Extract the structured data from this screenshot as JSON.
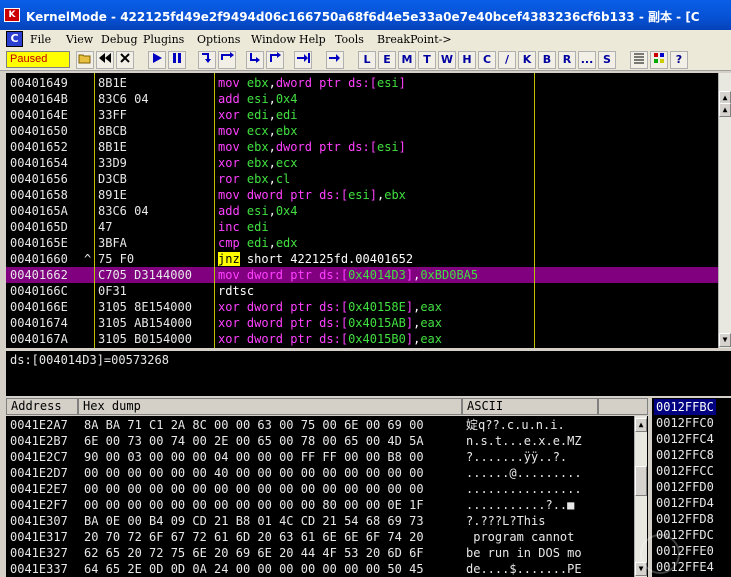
{
  "window": {
    "title": "KernelMode - 422125fd49e2f9494d06c166750a68f6d4e5e33a0e7e40bcef4383236cf6b133 - 副本 - [C",
    "icon_letter": "K"
  },
  "menu": {
    "c_label": "C",
    "items": [
      "File",
      "View",
      "Debug",
      "Plugins",
      "Options",
      "Window",
      "Help",
      "Tools",
      "BreakPoint->"
    ]
  },
  "toolbar": {
    "status": "Paused",
    "buttons_left": [
      "open-icon",
      "rewind-icon",
      "close-icon"
    ],
    "buttons_run": [
      "run-icon",
      "pause-icon"
    ],
    "buttons_step": [
      "step-into-icon",
      "step-over-icon",
      "trace-into-icon",
      "trace-over-icon",
      "execute-till-return-icon",
      "goto-icon"
    ],
    "letters": [
      "L",
      "E",
      "M",
      "T",
      "W",
      "H",
      "C",
      "/",
      "K",
      "B",
      "R",
      "...",
      "S"
    ],
    "buttons_right": [
      "list-icon",
      "grid-icon",
      "help-icon"
    ]
  },
  "disasm": {
    "rows": [
      {
        "addr": "00401649",
        "arrow": "",
        "hex": "8B1E",
        "asm": [
          [
            "m",
            "mov "
          ],
          [
            "r",
            "ebx"
          ],
          [
            "w",
            ","
          ],
          [
            "k",
            "dword ptr ds:["
          ],
          [
            "r",
            "esi"
          ],
          [
            "k",
            "]"
          ]
        ]
      },
      {
        "addr": "0040164B",
        "arrow": "",
        "hex": "83C6 04",
        "asm": [
          [
            "m",
            "add "
          ],
          [
            "r",
            "esi"
          ],
          [
            "w",
            ","
          ],
          [
            "n",
            "0x4"
          ]
        ]
      },
      {
        "addr": "0040164E",
        "arrow": "",
        "hex": "33FF",
        "asm": [
          [
            "m",
            "xor "
          ],
          [
            "r",
            "edi"
          ],
          [
            "w",
            ","
          ],
          [
            "r",
            "edi"
          ]
        ]
      },
      {
        "addr": "00401650",
        "arrow": "",
        "hex": "8BCB",
        "asm": [
          [
            "m",
            "mov "
          ],
          [
            "r",
            "ecx"
          ],
          [
            "w",
            ","
          ],
          [
            "r",
            "ebx"
          ]
        ]
      },
      {
        "addr": "00401652",
        "arrow": "",
        "hex": "8B1E",
        "asm": [
          [
            "m",
            "mov "
          ],
          [
            "r",
            "ebx"
          ],
          [
            "w",
            ","
          ],
          [
            "k",
            "dword ptr ds:["
          ],
          [
            "r",
            "esi"
          ],
          [
            "k",
            "]"
          ]
        ]
      },
      {
        "addr": "00401654",
        "arrow": "",
        "hex": "33D9",
        "asm": [
          [
            "m",
            "xor "
          ],
          [
            "r",
            "ebx"
          ],
          [
            "w",
            ","
          ],
          [
            "r",
            "ecx"
          ]
        ]
      },
      {
        "addr": "00401656",
        "arrow": "",
        "hex": "D3CB",
        "asm": [
          [
            "m",
            "ror "
          ],
          [
            "r",
            "ebx"
          ],
          [
            "w",
            ","
          ],
          [
            "r",
            "cl"
          ]
        ]
      },
      {
        "addr": "00401658",
        "arrow": "",
        "hex": "891E",
        "asm": [
          [
            "m",
            "mov "
          ],
          [
            "k",
            "dword ptr ds:["
          ],
          [
            "r",
            "esi"
          ],
          [
            "k",
            "]"
          ],
          [
            "w",
            ","
          ],
          [
            "r",
            "ebx"
          ]
        ]
      },
      {
        "addr": "0040165A",
        "arrow": "",
        "hex": "83C6 04",
        "asm": [
          [
            "m",
            "add "
          ],
          [
            "r",
            "esi"
          ],
          [
            "w",
            ","
          ],
          [
            "n",
            "0x4"
          ]
        ]
      },
      {
        "addr": "0040165D",
        "arrow": "",
        "hex": "47",
        "asm": [
          [
            "m",
            "inc "
          ],
          [
            "r",
            "edi"
          ]
        ]
      },
      {
        "addr": "0040165E",
        "arrow": "",
        "hex": "3BFA",
        "asm": [
          [
            "m",
            "cmp "
          ],
          [
            "r",
            "edi"
          ],
          [
            "w",
            ","
          ],
          [
            "r",
            "edx"
          ]
        ]
      },
      {
        "addr": "00401660",
        "arrow": "^",
        "hex": "75 F0",
        "asm": [
          [
            "jmp",
            "jnz"
          ],
          [
            "w",
            " short 422125fd.00401652"
          ]
        ]
      },
      {
        "addr": "00401662",
        "arrow": "",
        "hex": "C705 D3144000",
        "asm": [
          [
            "m",
            "mov "
          ],
          [
            "k",
            "dword ptr ds:["
          ],
          [
            "n",
            "0x4014D3"
          ],
          [
            "k",
            "]"
          ],
          [
            "w",
            ","
          ],
          [
            "n",
            "0xBD0BA5"
          ]
        ],
        "selected": true
      },
      {
        "addr": "0040166C",
        "arrow": "",
        "hex": "0F31",
        "asm": [
          [
            "w",
            "rdtsc"
          ]
        ]
      },
      {
        "addr": "0040166E",
        "arrow": "",
        "hex": "3105 8E154000",
        "asm": [
          [
            "m",
            "xor "
          ],
          [
            "k",
            "dword ptr ds:["
          ],
          [
            "n",
            "0x40158E"
          ],
          [
            "k",
            "]"
          ],
          [
            "w",
            ","
          ],
          [
            "r",
            "eax"
          ]
        ]
      },
      {
        "addr": "00401674",
        "arrow": "",
        "hex": "3105 AB154000",
        "asm": [
          [
            "m",
            "xor "
          ],
          [
            "k",
            "dword ptr ds:["
          ],
          [
            "n",
            "0x4015AB"
          ],
          [
            "k",
            "]"
          ],
          [
            "w",
            ","
          ],
          [
            "r",
            "eax"
          ]
        ]
      },
      {
        "addr": "0040167A",
        "arrow": "",
        "hex": "3105 B0154000",
        "asm": [
          [
            "m",
            "xor "
          ],
          [
            "k",
            "dword ptr ds:["
          ],
          [
            "n",
            "0x4015B0"
          ],
          [
            "k",
            "]"
          ],
          [
            "w",
            ","
          ],
          [
            "r",
            "eax"
          ]
        ]
      }
    ]
  },
  "info": {
    "line": "ds:[004014D3]=00573268"
  },
  "dump": {
    "headers": {
      "address": "Address",
      "hex": "Hex dump",
      "ascii": "ASCII"
    },
    "rows": [
      {
        "addr": "0041E2A7",
        "hex": "8A BA 71 C1 2A 8C 00 00 63 00 75 00 6E 00 69 00",
        "ascii": "婝q??.c.u.n.i."
      },
      {
        "addr": "0041E2B7",
        "hex": "6E 00 73 00 74 00 2E 00 65 00 78 00 65 00 4D 5A",
        "ascii": "n.s.t...e.x.e.MZ"
      },
      {
        "addr": "0041E2C7",
        "hex": "90 00 03 00 00 00 04 00 00 00 FF FF 00 00 B8 00",
        "ascii": "?.......ÿÿ..?."
      },
      {
        "addr": "0041E2D7",
        "hex": "00 00 00 00 00 00 40 00 00 00 00 00 00 00 00 00",
        "ascii": "......@........."
      },
      {
        "addr": "0041E2E7",
        "hex": "00 00 00 00 00 00 00 00 00 00 00 00 00 00 00 00",
        "ascii": "................"
      },
      {
        "addr": "0041E2F7",
        "hex": "00 00 00 00 00 00 00 00 00 00 00 80 00 00 0E 1F",
        "ascii": "...........?..■"
      },
      {
        "addr": "0041E307",
        "hex": "BA 0E 00 B4 09 CD 21 B8 01 4C CD 21 54 68 69 73",
        "ascii": "?.???L?This"
      },
      {
        "addr": "0041E317",
        "hex": "20 70 72 6F 67 72 61 6D 20 63 61 6E 6E 6F 74 20",
        "ascii": " program cannot "
      },
      {
        "addr": "0041E327",
        "hex": "62 65 20 72 75 6E 20 69 6E 20 44 4F 53 20 6D 6F",
        "ascii": "be run in DOS mo"
      },
      {
        "addr": "0041E337",
        "hex": "64 65 2E 0D 0D 0A 24 00 00 00 00 00 00 00 50 45",
        "ascii": "de....$.......PE"
      }
    ]
  },
  "stack": {
    "rows": [
      "0012FFBC",
      "0012FFC0",
      "0012FFC4",
      "0012FFC8",
      "0012FFCC",
      "0012FFD0",
      "0012FFD4",
      "0012FFD8",
      "0012FFDC",
      "0012FFE0",
      "0012FFE4"
    ]
  }
}
